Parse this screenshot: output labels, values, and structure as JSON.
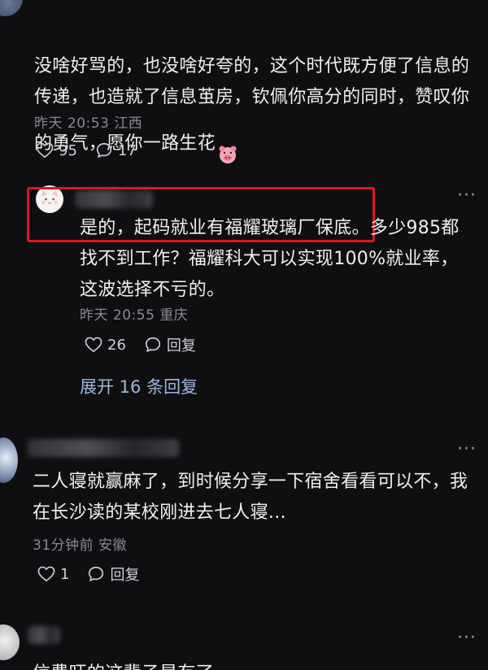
{
  "comments": [
    {
      "text": "没啥好骂的，也没啥好夸的，这个时代既方便了信息的\n传递，也造就了信息茧房，钦佩你高分的同时，赞叹你\n的勇气，愿你一路生花",
      "time": "昨天 20:53",
      "location": "江西",
      "likes": "95",
      "replies": "17"
    },
    {
      "text": "是的，起码就业有福耀玻璃厂保底。多少985都\n找不到工作？福耀科大可以实现100%就业率，\n这波选择不亏的。",
      "time": "昨天 20:55",
      "location": "重庆",
      "likes": "26",
      "reply_label": "回复",
      "expand_label": "展开 16 条回复"
    },
    {
      "text": "二人寝就赢麻了，到时候分享一下宿舍看看可以不，我\n在长沙读的某校刚进去七人寝...",
      "time": "31分钟前",
      "location": "安徽",
      "likes": "1",
      "reply_label": "回复"
    },
    {
      "text": "信费旺的这辈子是有了"
    }
  ],
  "more_glyph": "···",
  "colors": {
    "highlight": "#e0141f",
    "link": "#9fb6da",
    "meta": "#8a8a90"
  },
  "icons": [
    "heart-icon",
    "comment-icon",
    "more-icon",
    "pig-emoji-icon"
  ]
}
